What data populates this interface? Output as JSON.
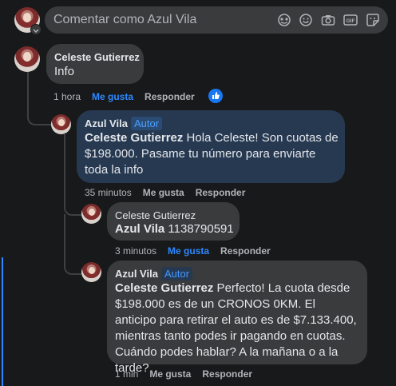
{
  "composer": {
    "placeholder": "Comentar como Azul Vila"
  },
  "comments": [
    {
      "author": "Celeste Gutierrez",
      "text": "Info",
      "time": "1 hora",
      "like": "Me gusta",
      "reply": "Responder"
    },
    {
      "author": "Azul Vila",
      "badge": "Autor",
      "mention": "Celeste Gutierrez",
      "text": " Hola Celeste! Son cuotas de $198.000. Pasame tu número para enviarte toda la info",
      "time": "35 minutos",
      "like": "Me gusta",
      "reply": "Responder"
    },
    {
      "author": "Celeste Gutierrez",
      "mention": "Azul Vila",
      "text": " 1138790591",
      "time": "3 minutos",
      "like": "Me gusta",
      "reply": "Responder"
    },
    {
      "author": "Azul Vila",
      "badge": "Autor",
      "mention": "Celeste Gutierrez",
      "text": " Perfecto! La cuota desde $198.000 es de un CRONOS 0KM. El anticipo para retirar el auto es de $7.133.400, mientras tanto podes ir pagando en cuotas. Cuándo podes hablar? A la mañana o a la tarde?",
      "time": "1 min",
      "like": "Me gusta",
      "reply": "Responder"
    }
  ],
  "colors": {
    "background": "#18191a",
    "bubble": "#3a3b3c",
    "author_bubble": "#263951",
    "accent": "#2d88ff"
  }
}
